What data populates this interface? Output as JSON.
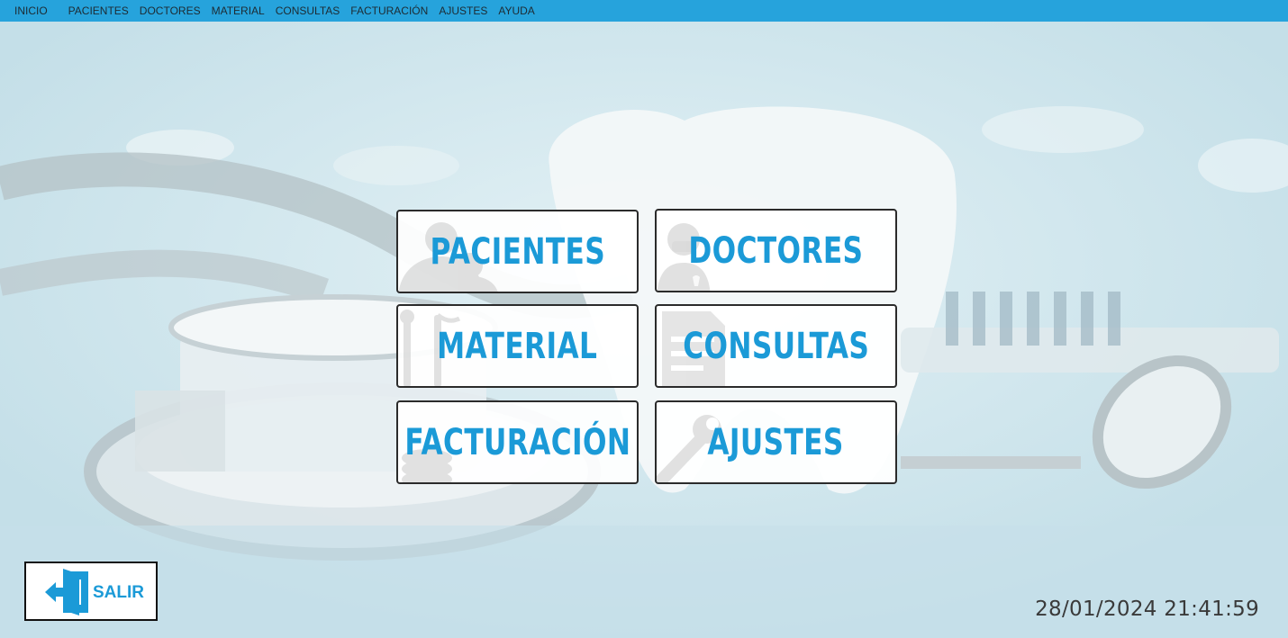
{
  "menu": {
    "items": [
      {
        "label": "INICIO"
      },
      {
        "label": "PACIENTES"
      },
      {
        "label": "DOCTORES"
      },
      {
        "label": "MATERIAL"
      },
      {
        "label": "CONSULTAS"
      },
      {
        "label": "FACTURACIÓN"
      },
      {
        "label": "AJUSTES"
      },
      {
        "label": "AYUDA"
      }
    ]
  },
  "tiles": [
    {
      "label": "PACIENTES",
      "icon": "patients-icon"
    },
    {
      "label": "DOCTORES",
      "icon": "doctor-icon"
    },
    {
      "label": "MATERIAL",
      "icon": "dental-tools-icon"
    },
    {
      "label": "CONSULTAS",
      "icon": "document-icon"
    },
    {
      "label": "FACTURACIÓN",
      "icon": "coins-icon"
    },
    {
      "label": "AJUSTES",
      "icon": "wrench-icon"
    }
  ],
  "exit_button": {
    "label": "SALIR",
    "icon": "exit-door-icon"
  },
  "clock": {
    "datetime": "28/01/2024 21:41:59"
  },
  "colors": {
    "menubar": "#26a3dc",
    "accent": "#1b9ad7",
    "tile_border": "#2b2b2b",
    "background": "#cfe6ee"
  }
}
